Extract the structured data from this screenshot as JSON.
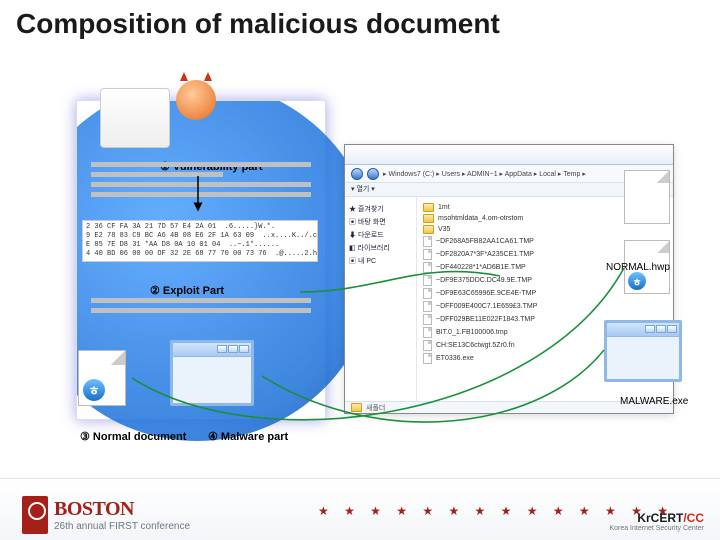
{
  "title": "Composition of malicious document",
  "labels": {
    "vuln": "① Vulnerability part",
    "exploit": "② Exploit Part",
    "normal_doc": "③ Normal document",
    "malware_part": "④ Malware part"
  },
  "callouts": {
    "normal_hwp": "NORMAL.hwp",
    "malware_exe": "MALWARE.exe"
  },
  "hwp_glyph": "ㅎ",
  "hex_lines": [
    "2 36 CF FA 3A 21 7D 57 E4 2A 01  .6.....}W.*.",
    "9 E2 78 83 C9 BC A6 4B 08 E6 2F 1A 63 09  ..x....K../.c.",
    "E 85 7E D8 31 *AA D8 0A 10 01 04  ..~.1*......",
    "4 40 BD 06 00 00 OF 32 2E 68 77 70 00 73 76  .@.....2.hwp.sv"
  ],
  "explorer": {
    "address": "▸ Windows7 (C:) ▸ Users ▸ ADMIN~1 ▸ AppData ▸ Local ▸ Temp ▸",
    "toolbar": "▾ 열기 ▾",
    "sidebar": {
      "items": [
        {
          "label": "★ 즐겨찾기"
        },
        {
          "label": "▣ 바탕 화면"
        },
        {
          "label": "⬇ 다운로드"
        },
        {
          "label": "◧ 라이브러리"
        },
        {
          "label": "▣ 내 PC"
        }
      ]
    },
    "folders": [
      "1mt",
      "msohtmldata_4.om-otrstom",
      "V35"
    ],
    "files": [
      "~DF268A5FB82AA1CA61.TMP",
      "~DF2820A7*3F*A235CE1.TMP",
      "~DF440228*1*AD6B1E.TMP",
      "~DF9E375DDC.DC49.9E.TMP",
      "~DF9E63C65996E.9CE4E-TMP",
      "~DFF009E400C7.1E659£3.TMP",
      "~DFF029BE11E022F1843.TMP",
      "BIT.0_1.FB100006.tmp",
      "CH:SE13C6ctwgt.5Zr0.fn",
      "ET0336.exe"
    ],
    "footer": "새폴더"
  },
  "footer": {
    "brand": "BOSTON",
    "conference": "26th annual FIRST conference",
    "stars": "★ ★ ★ ★ ★ ★ ★ ★ ★ ★ ★ ★ ★ ★",
    "krcert_main": "KrCERT",
    "krcert_cc": "/CC",
    "krcert_sub": "Korea Internet Security Center"
  }
}
